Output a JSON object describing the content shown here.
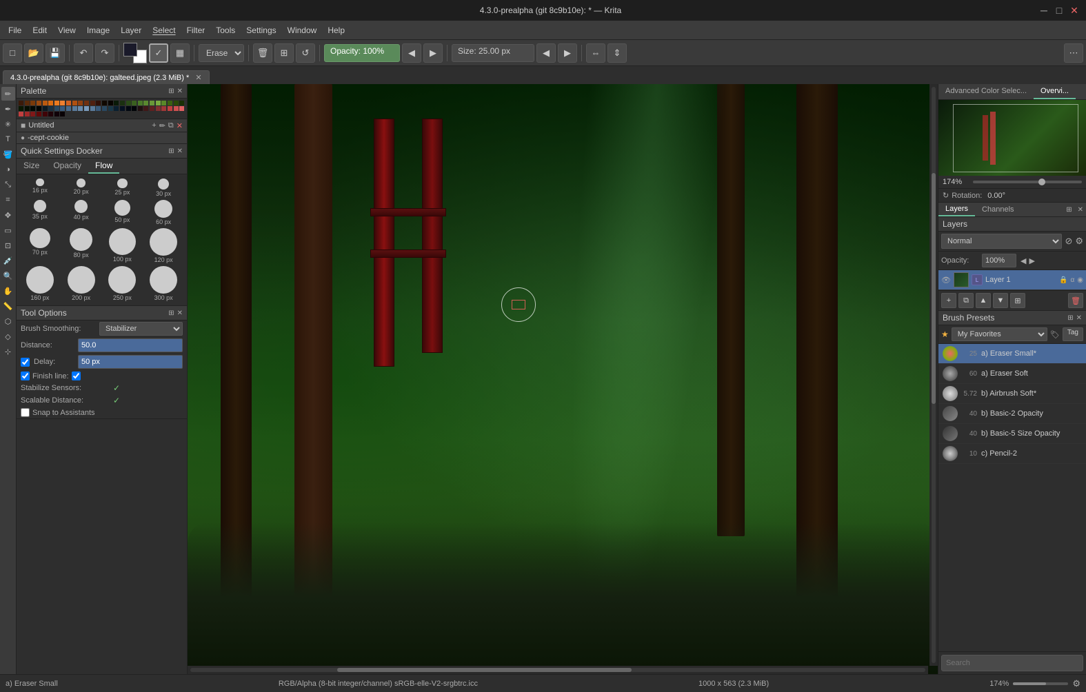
{
  "titlebar": {
    "title": "4.3.0-prealpha (git 8c9b10e): * — Krita",
    "controls": [
      "minimize",
      "maximize",
      "close"
    ]
  },
  "menubar": {
    "items": [
      "File",
      "Edit",
      "View",
      "Image",
      "Layer",
      "Select",
      "Filter",
      "Tools",
      "Settings",
      "Window",
      "Help"
    ]
  },
  "toolbar": {
    "erase_label": "Erase",
    "opacity_label": "Opacity: 100%",
    "size_label": "Size: 25.00 px"
  },
  "doc_tab": {
    "title": "4.3.0-prealpha (git 8c9b10e): galteed.jpeg (2.3 MiB) *"
  },
  "palette": {
    "title": "Palette"
  },
  "brush_name": {
    "prefix": "...",
    "name": "-cept-cookie"
  },
  "quick_settings": {
    "title": "Quick Settings Docker",
    "tabs": [
      "Size",
      "Opacity",
      "Flow"
    ],
    "active_tab": "Flow",
    "brush_sizes": [
      {
        "size": 16,
        "px": "16 px"
      },
      {
        "size": 20,
        "px": "20 px"
      },
      {
        "size": 25,
        "px": "25 px"
      },
      {
        "size": 30,
        "px": "30 px"
      },
      {
        "size": 35,
        "px": "35 px"
      },
      {
        "size": 40,
        "px": "40 px"
      },
      {
        "size": 50,
        "px": "50 px"
      },
      {
        "size": 60,
        "px": "60 px"
      },
      {
        "size": 70,
        "px": "70 px"
      },
      {
        "size": 80,
        "px": "80 px"
      },
      {
        "size": 100,
        "px": "100 px"
      },
      {
        "size": 120,
        "px": "120 px"
      },
      {
        "size": 160,
        "px": "160 px"
      },
      {
        "size": 200,
        "px": "200 px"
      },
      {
        "size": 250,
        "px": "250 px"
      },
      {
        "size": 300,
        "px": "300 px"
      }
    ]
  },
  "tool_options": {
    "title": "Tool Options",
    "rows": [
      {
        "label": "Brush Smoothing:",
        "type": "combo",
        "value": "Stabilizer"
      },
      {
        "label": "Distance:",
        "type": "input",
        "value": "50.0"
      },
      {
        "label": "Delay:",
        "type": "input_check",
        "value": "50 px",
        "checked": true
      },
      {
        "label": "Finish line:",
        "type": "check",
        "checked": true
      },
      {
        "label": "Stabilize Sensors:",
        "type": "check",
        "checked": true
      },
      {
        "label": "Scalable Distance:",
        "type": "check",
        "checked": true
      }
    ],
    "snap_assistants": "Snap to Assistants"
  },
  "overview": {
    "tabs": [
      "Advanced Color Selec...",
      "Overvi..."
    ],
    "active_tab": "Overvi...",
    "zoom_pct": "174%",
    "rotation_label": "Rotation:",
    "rotation_value": "0.00°"
  },
  "layers": {
    "title": "Layers",
    "tabs": [
      "Layers",
      "Channels"
    ],
    "active_tab": "Layers",
    "blend_mode": "Normal",
    "opacity_label": "Opacity:",
    "opacity_value": "100%",
    "items": [
      {
        "name": "Layer 1",
        "selected": true
      }
    ]
  },
  "brush_presets": {
    "title": "Brush Presets",
    "filter": "My Favorites",
    "tag_label": "Tag",
    "items": [
      {
        "num": "25",
        "name": "a) Eraser Small*",
        "selected": true
      },
      {
        "num": "60",
        "name": "a) Eraser Soft"
      },
      {
        "num": "5.72",
        "name": "b) Airbrush Soft*"
      },
      {
        "num": "40",
        "name": "b) Basic-2 Opacity"
      },
      {
        "num": "40",
        "name": "b) Basic-5 Size Opacity"
      },
      {
        "num": "10",
        "name": "c) Pencil-2"
      }
    ]
  },
  "search": {
    "placeholder": "Search",
    "value": ""
  },
  "statusbar": {
    "brush_label": "a) Eraser Small",
    "color_info": "RGB/Alpha (8-bit integer/channel)  sRGB-elle-V2-srgbtrc.icc",
    "dimensions": "1000 x 563 (2.3 MiB)",
    "zoom": "174%"
  },
  "swatches": [
    "#3a1a0a",
    "#5a2a0a",
    "#7a3a0a",
    "#9a4a10",
    "#ba5a10",
    "#da6a10",
    "#ea7a20",
    "#f08030",
    "#d06020",
    "#b05010",
    "#904010",
    "#703010",
    "#502010",
    "#301008",
    "#100800",
    "#080400",
    "#0a1a08",
    "#1a3010",
    "#2a4a18",
    "#3a6020",
    "#4a7828",
    "#5a8830",
    "#6a9838",
    "#7aaa40",
    "#5a8828",
    "#3a6010",
    "#2a4808",
    "#1a3005",
    "#0a1802",
    "#050e01",
    "#020802",
    "#010401",
    "#0a1820",
    "#1a3040",
    "#2a4860",
    "#3a5a7a",
    "#4a6a8a",
    "#5a7a9a",
    "#6a8aaa",
    "#7a9aba",
    "#5a7a9a",
    "#3a5a7a",
    "#2a4860",
    "#1a3848",
    "#0a2030",
    "#051020",
    "#020810",
    "#010408",
    "#201010",
    "#401818",
    "#602020",
    "#803030",
    "#a03838",
    "#c04040",
    "#d05050",
    "#e06060",
    "#c04040",
    "#a02828",
    "#801818",
    "#600808",
    "#400408",
    "#200208",
    "#100108",
    "#080104"
  ]
}
